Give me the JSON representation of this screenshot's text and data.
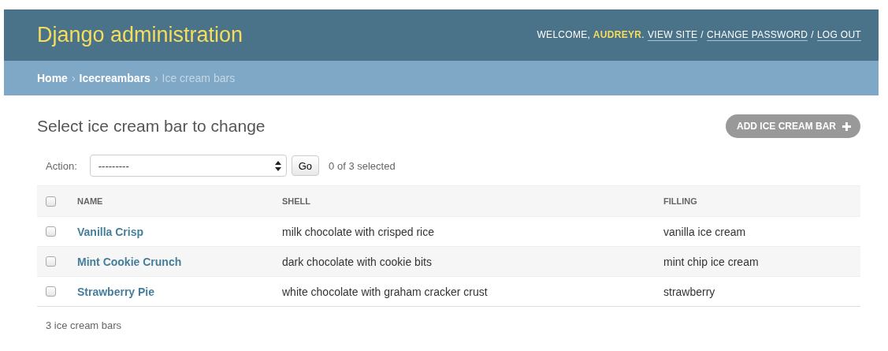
{
  "header": {
    "branding": "Django administration",
    "welcome": "WELCOME, **AUDREYR**.",
    "links": [
      "VIEW SITE",
      "CHANGE PASSWORD",
      "LOG OUT"
    ],
    "separators": [
      "/",
      "/"
    ]
  },
  "breadcrumbs": {
    "links": [
      "Home",
      "Icecreambars"
    ],
    "separators": [
      "›",
      "›"
    ],
    "current": "Ice cream bars"
  },
  "title": "Select ice cream bar to change",
  "add_button": "ADD ICE CREAM BAR",
  "actions": {
    "label": "Action:",
    "select_value": "---------",
    "go": "Go",
    "counter": "0 of 3 selected"
  },
  "table": {
    "select_all_checked": false,
    "columns": [
      "NAME",
      "SHELL",
      "FILLING"
    ],
    "rows": [
      {
        "checked": false,
        "cells": [
          "Vanilla Crisp",
          "milk chocolate with crisped rice",
          "vanilla ice cream"
        ]
      },
      {
        "checked": false,
        "cells": [
          "Mint Cookie Crunch",
          "dark chocolate with cookie bits",
          "mint chip ice cream"
        ]
      },
      {
        "checked": false,
        "cells": [
          "Strawberry Pie",
          "white chocolate with graham cracker crust",
          "strawberry"
        ]
      }
    ]
  },
  "paginator": "3 ice cream bars"
}
